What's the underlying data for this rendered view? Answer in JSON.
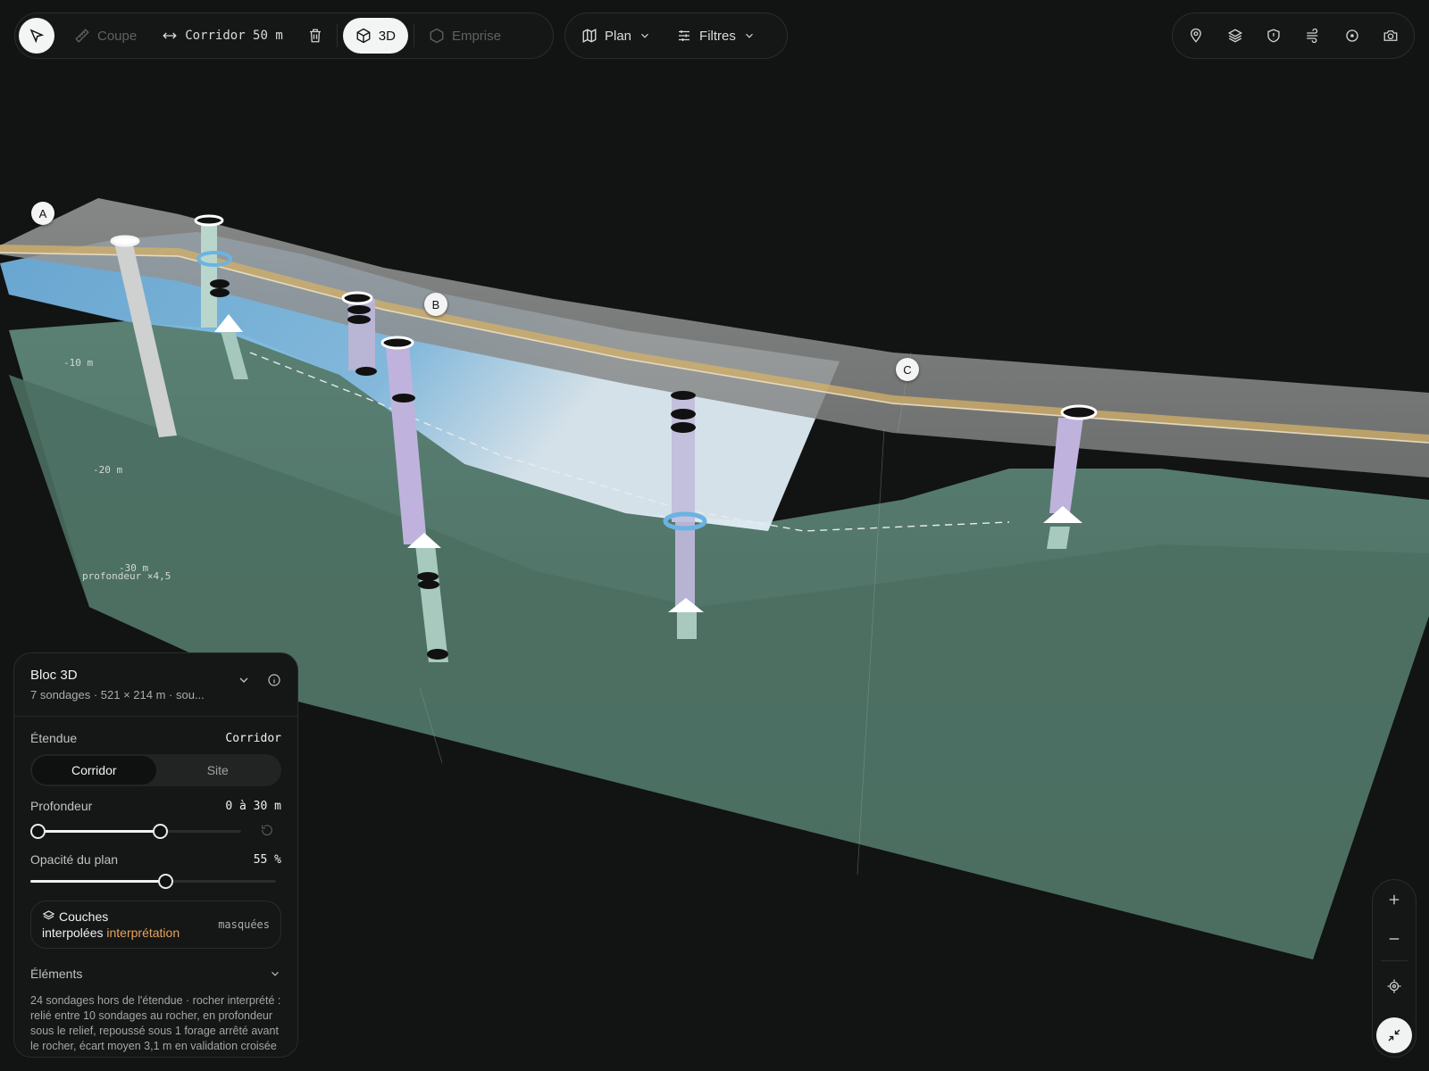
{
  "toolbar": {
    "coupe_label": "Coupe",
    "corridor_label": "Corridor 50 m",
    "view_3d_label": "3D",
    "emprise_label": "Emprise",
    "plan_label": "Plan",
    "filtres_label": "Filtres"
  },
  "right_toolbar_icons": [
    "map-pin-icon",
    "layers-icon",
    "shield-icon",
    "wind-icon",
    "target-icon",
    "camera-icon"
  ],
  "scene": {
    "markers": [
      "A",
      "B",
      "C"
    ],
    "depth_labels": [
      "-10 m",
      "-20 m",
      "-30 m"
    ],
    "exaggeration": "profondeur ×4,5",
    "colors": {
      "bedrock": "#557a6d",
      "water": "#74b7e3",
      "road": "#8a8c8c",
      "road_line": "#d4b067",
      "borehole": "#b9b5d4"
    }
  },
  "panel": {
    "title": "Bloc 3D",
    "subtitle": "7 sondages · 521 × 214 m · sou...",
    "etendue_label": "Étendue",
    "etendue_value": "Corridor",
    "seg_corridor": "Corridor",
    "seg_site": "Site",
    "profondeur_label": "Profondeur",
    "profondeur_value": "0 à 30 m",
    "profondeur_range": [
      0,
      30
    ],
    "opacity_label": "Opacité du plan",
    "opacity_value": "55 %",
    "opacity_fraction": 0.55,
    "layers_label": "Couches",
    "layers_label2": "interpolées",
    "layers_accent": "interprétation",
    "layers_state": "masquées",
    "elements_label": "Éléments",
    "footer_text": "24 sondages hors de l'étendue · rocher interprété : relié entre 10 sondages au rocher, en profondeur sous le relief, repoussé sous 1 forage arrêté avant le rocher, écart moyen 3,1 m en validation croisée"
  }
}
